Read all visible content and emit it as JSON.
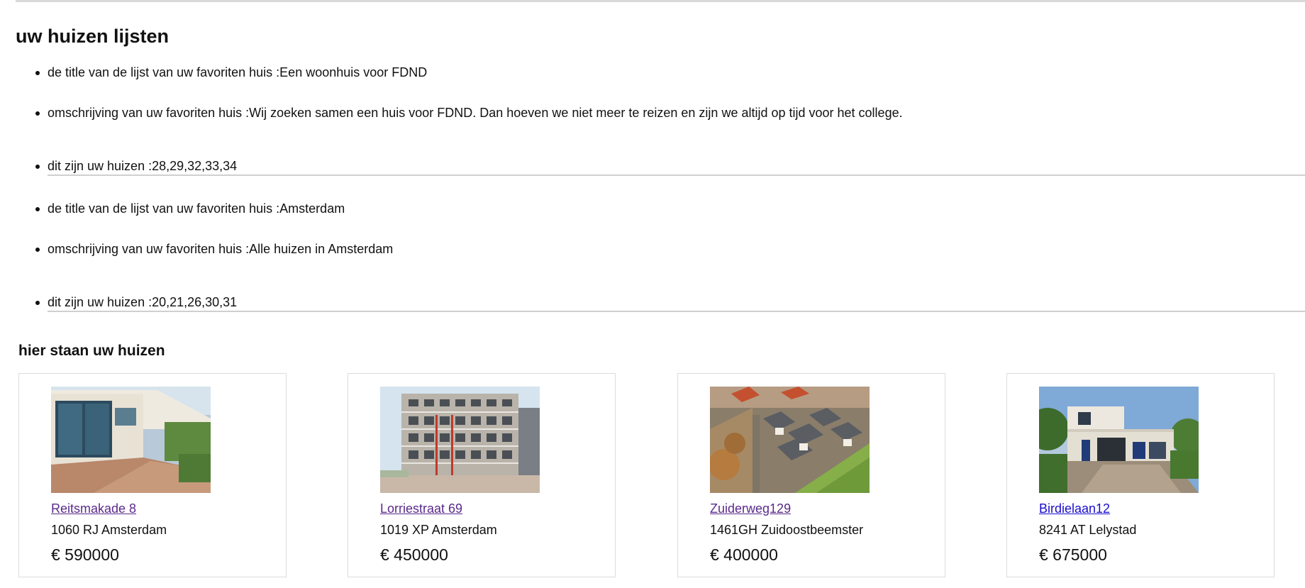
{
  "page": {
    "title": "uw huizen lijsten",
    "section_title": "hier staan uw huizen"
  },
  "lists": [
    {
      "title_line": "de title van de lijst van uw favoriten huis :Een woonhuis voor FDND",
      "description_line": "omschrijving van uw favoriten huis :Wij zoeken samen een huis voor FDND. Dan hoeven we niet meer te reizen en zijn we altijd op tijd voor het college.",
      "houses_line": "dit zijn uw huizen :28,29,32,33,34"
    },
    {
      "title_line": "de title van de lijst van uw favoriten huis :Amsterdam",
      "description_line": "omschrijving van uw favoriten huis :Alle huizen in Amsterdam",
      "houses_line": "dit zijn uw huizen :20,21,26,30,31"
    }
  ],
  "houses": [
    {
      "street": "Reitsmakade 8",
      "city": "1060 RJ Amsterdam",
      "price": "€ 590000",
      "link_state": "visited",
      "photo": "bungalow-terrace-photo"
    },
    {
      "street": "Lorriestraat 69",
      "city": "1019 XP Amsterdam",
      "price": "€ 450000",
      "link_state": "visited",
      "photo": "apartment-building-photo"
    },
    {
      "street": "Zuiderweg129",
      "city": "1461GH Zuidoostbeemster",
      "price": "€ 400000",
      "link_state": "visited",
      "photo": "aerial-village-photo"
    },
    {
      "street": "Birdielaan12",
      "city": "8241 AT Lelystad",
      "price": "€ 675000",
      "link_state": "unvisited",
      "photo": "modern-villa-photo"
    }
  ],
  "colors": {
    "visited_link": "#5a2a8c",
    "unvisited_link": "#1a0dcc",
    "rule": "#cfcfcf",
    "card_border": "#dcdcdc"
  }
}
